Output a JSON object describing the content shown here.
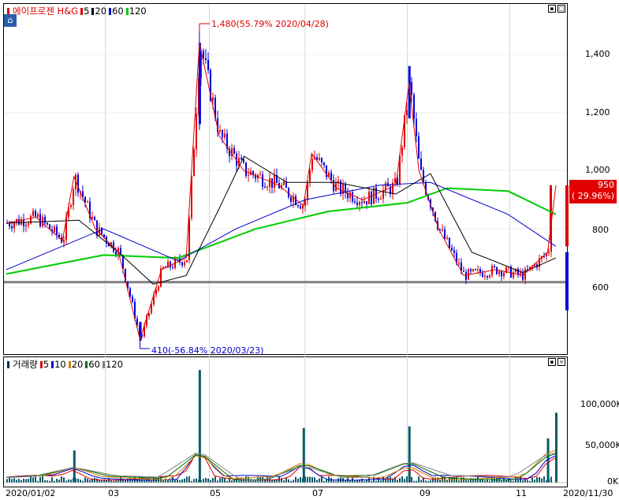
{
  "price_panel": {
    "legend": {
      "stock_name": "에이프로젠 H&G",
      "ma_items": [
        {
          "label": "5",
          "color": "#e00000"
        },
        {
          "label": "20",
          "color": "#000000"
        },
        {
          "label": "60",
          "color": "#0000cc"
        },
        {
          "label": "120",
          "color": "#00cc00"
        }
      ]
    },
    "y_ticks": [
      "1,400",
      "1,200",
      "1,000",
      "800",
      "600"
    ],
    "current_price": "950",
    "current_change": "( 29.96%)",
    "high_annotation": "1,480(55.79% 2020/04/28)",
    "low_annotation": "410(-56.84% 2020/03/23)",
    "colors": {
      "up": "#e00000",
      "down": "#0000dd",
      "ma5": "#e00000",
      "ma20": "#000000",
      "ma60": "#0000cc",
      "ma120": "#00cc00",
      "baseline": "#808080"
    }
  },
  "volume_panel": {
    "legend": {
      "title": "거래량",
      "ma_items": [
        {
          "label": "5",
          "color": "#e00000"
        },
        {
          "label": "10",
          "color": "#0000cc"
        },
        {
          "label": "20",
          "color": "#d08000"
        },
        {
          "label": "60",
          "color": "#007000"
        },
        {
          "label": "120",
          "color": "#808080"
        }
      ]
    },
    "y_ticks": [
      "100,000K",
      "50,000K",
      "0K"
    ]
  },
  "x_ticks": [
    "2020/01/02",
    "03",
    "05",
    "07",
    "09",
    "11",
    "2020/11/30"
  ],
  "chart_data": {
    "type": "candlestick",
    "ylim": [
      420,
      1500
    ],
    "high": 1480,
    "low": 410,
    "baseline": 617,
    "close_series": [
      {
        "date": "2020/01/02",
        "value": 820
      },
      {
        "date": "2020/01/20",
        "value": 840
      },
      {
        "date": "2020/02/05",
        "value": 760
      },
      {
        "date": "2020/02/12",
        "value": 980
      },
      {
        "date": "2020/02/25",
        "value": 800
      },
      {
        "date": "2020/03/10",
        "value": 720
      },
      {
        "date": "2020/03/23",
        "value": 420
      },
      {
        "date": "2020/04/05",
        "value": 660
      },
      {
        "date": "2020/04/20",
        "value": 700
      },
      {
        "date": "2020/04/28",
        "value": 1440
      },
      {
        "date": "2020/05/10",
        "value": 1120
      },
      {
        "date": "2020/05/25",
        "value": 1000
      },
      {
        "date": "2020/06/15",
        "value": 950
      },
      {
        "date": "2020/06/30",
        "value": 880
      },
      {
        "date": "2020/07/05",
        "value": 1060
      },
      {
        "date": "2020/07/20",
        "value": 940
      },
      {
        "date": "2020/08/05",
        "value": 900
      },
      {
        "date": "2020/08/25",
        "value": 950
      },
      {
        "date": "2020/09/02",
        "value": 1300
      },
      {
        "date": "2020/09/08",
        "value": 1000
      },
      {
        "date": "2020/09/20",
        "value": 800
      },
      {
        "date": "2020/10/05",
        "value": 640
      },
      {
        "date": "2020/10/25",
        "value": 660
      },
      {
        "date": "2020/11/10",
        "value": 640
      },
      {
        "date": "2020/11/25",
        "value": 720
      },
      {
        "date": "2020/11/30",
        "value": 950
      }
    ],
    "ma20": [
      {
        "date": "2020/01/02",
        "value": 820
      },
      {
        "date": "2020/02/15",
        "value": 830
      },
      {
        "date": "2020/03/10",
        "value": 720
      },
      {
        "date": "2020/03/31",
        "value": 610
      },
      {
        "date": "2020/04/20",
        "value": 640
      },
      {
        "date": "2020/05/10",
        "value": 870
      },
      {
        "date": "2020/05/25",
        "value": 1050
      },
      {
        "date": "2020/06/20",
        "value": 960
      },
      {
        "date": "2020/07/20",
        "value": 960
      },
      {
        "date": "2020/08/25",
        "value": 920
      },
      {
        "date": "2020/09/15",
        "value": 990
      },
      {
        "date": "2020/10/10",
        "value": 720
      },
      {
        "date": "2020/11/10",
        "value": 650
      },
      {
        "date": "2020/11/30",
        "value": 700
      }
    ],
    "ma60": [
      {
        "date": "2020/01/02",
        "value": 660
      },
      {
        "date": "2020/03/01",
        "value": 800
      },
      {
        "date": "2020/04/15",
        "value": 690
      },
      {
        "date": "2020/05/20",
        "value": 800
      },
      {
        "date": "2020/07/01",
        "value": 900
      },
      {
        "date": "2020/08/15",
        "value": 950
      },
      {
        "date": "2020/09/15",
        "value": 960
      },
      {
        "date": "2020/11/01",
        "value": 850
      },
      {
        "date": "2020/11/30",
        "value": 740
      }
    ],
    "ma120": [
      {
        "date": "2020/01/02",
        "value": 645
      },
      {
        "date": "2020/03/01",
        "value": 710
      },
      {
        "date": "2020/04/15",
        "value": 700
      },
      {
        "date": "2020/06/01",
        "value": 800
      },
      {
        "date": "2020/07/15",
        "value": 860
      },
      {
        "date": "2020/09/01",
        "value": 890
      },
      {
        "date": "2020/09/25",
        "value": 940
      },
      {
        "date": "2020/11/01",
        "value": 930
      },
      {
        "date": "2020/11/30",
        "value": 850
      }
    ],
    "volume": [
      {
        "date": "2020/02/12",
        "value": 40000
      },
      {
        "date": "2020/04/28",
        "value": 140000
      },
      {
        "date": "2020/06/30",
        "value": 68000
      },
      {
        "date": "2020/09/02",
        "value": 70000
      },
      {
        "date": "2020/11/25",
        "value": 55000
      },
      {
        "date": "2020/11/30",
        "value": 87000
      }
    ]
  }
}
